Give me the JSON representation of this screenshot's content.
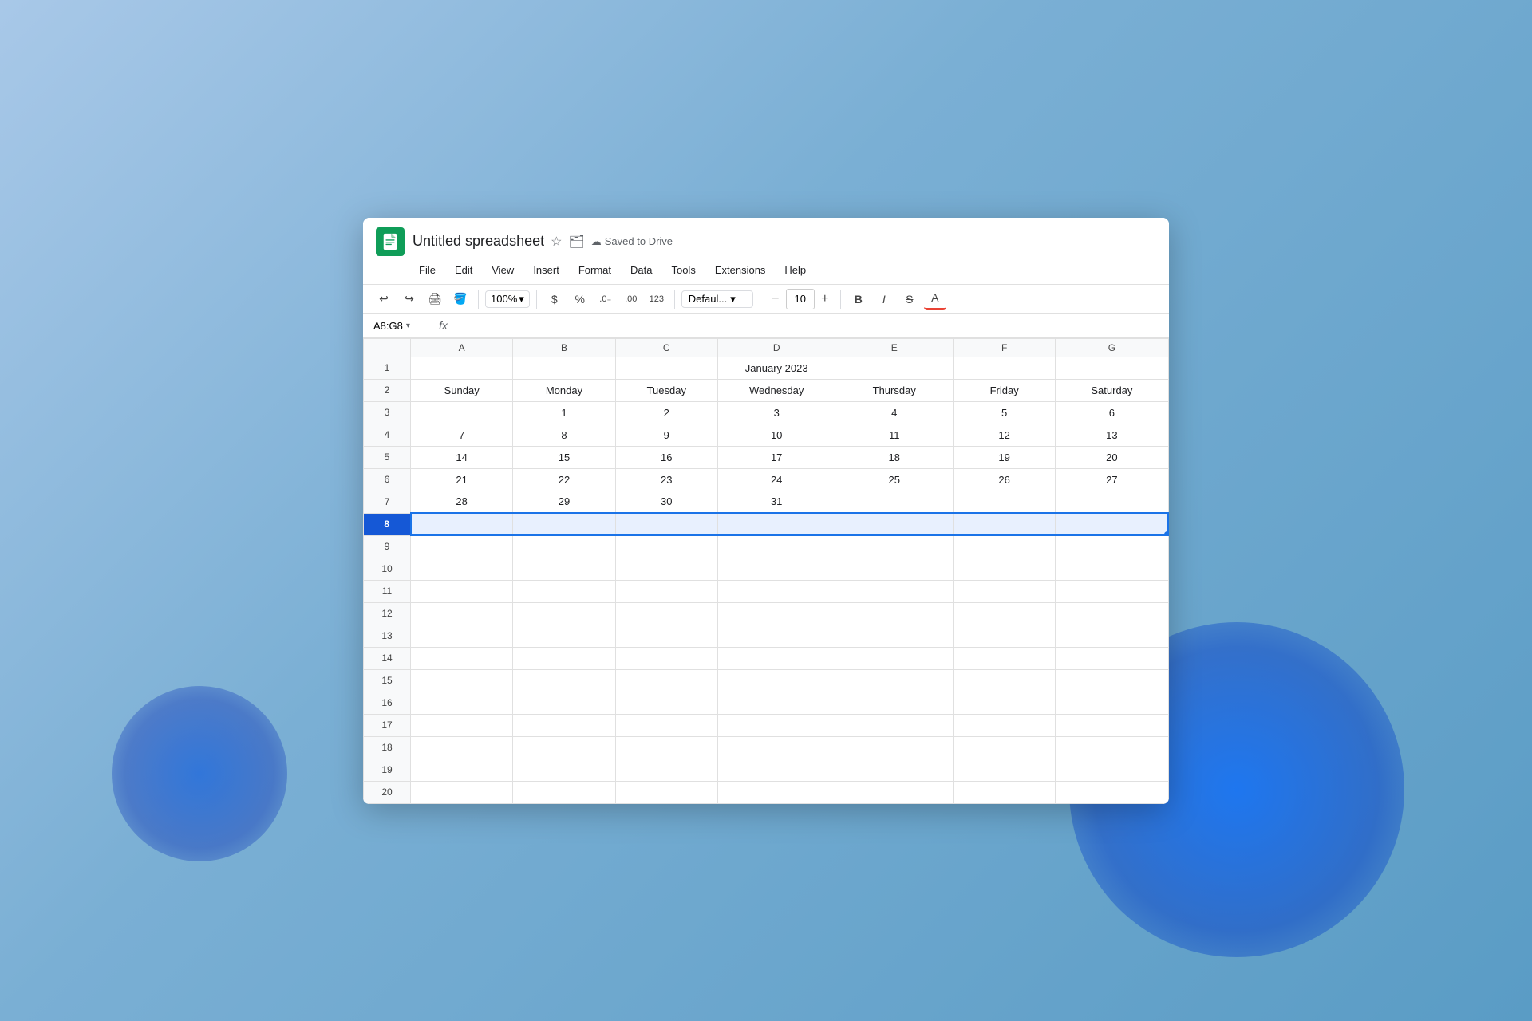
{
  "window": {
    "title": "Untitled spreadsheet",
    "saved_label": "Saved to Drive",
    "logo_alt": "Google Sheets logo"
  },
  "menu": {
    "items": [
      "File",
      "Edit",
      "View",
      "Insert",
      "Format",
      "Data",
      "Tools",
      "Extensions",
      "Help"
    ]
  },
  "toolbar": {
    "zoom": "100%",
    "font": "Defaul...",
    "font_size": "10",
    "currency_symbol": "$",
    "percent_symbol": "%",
    "decimal_label": ".0",
    "more_decimal": ".00",
    "number_label": "123"
  },
  "formula_bar": {
    "cell_ref": "A8:G8",
    "fx_label": "fx"
  },
  "columns": [
    "A",
    "B",
    "C",
    "D",
    "E",
    "F",
    "G"
  ],
  "spreadsheet": {
    "title_row": "January 2023",
    "headers": [
      "Sunday",
      "Monday",
      "Tuesday",
      "Wednesday",
      "Thursday",
      "Friday",
      "Saturday"
    ],
    "rows": [
      [
        "",
        "1",
        "2",
        "3",
        "4",
        "5",
        "6"
      ],
      [
        "7",
        "8",
        "9",
        "10",
        "11",
        "12",
        "13"
      ],
      [
        "14",
        "15",
        "16",
        "17",
        "18",
        "19",
        "20"
      ],
      [
        "21",
        "22",
        "23",
        "24",
        "25",
        "26",
        "27"
      ],
      [
        "28",
        "29",
        "30",
        "31",
        "",
        "",
        ""
      ]
    ],
    "selected_row": 8
  },
  "row_numbers": [
    1,
    2,
    3,
    4,
    5,
    6,
    7,
    8,
    9,
    10,
    11,
    12,
    13,
    14,
    15,
    16,
    17,
    18,
    19,
    20
  ]
}
